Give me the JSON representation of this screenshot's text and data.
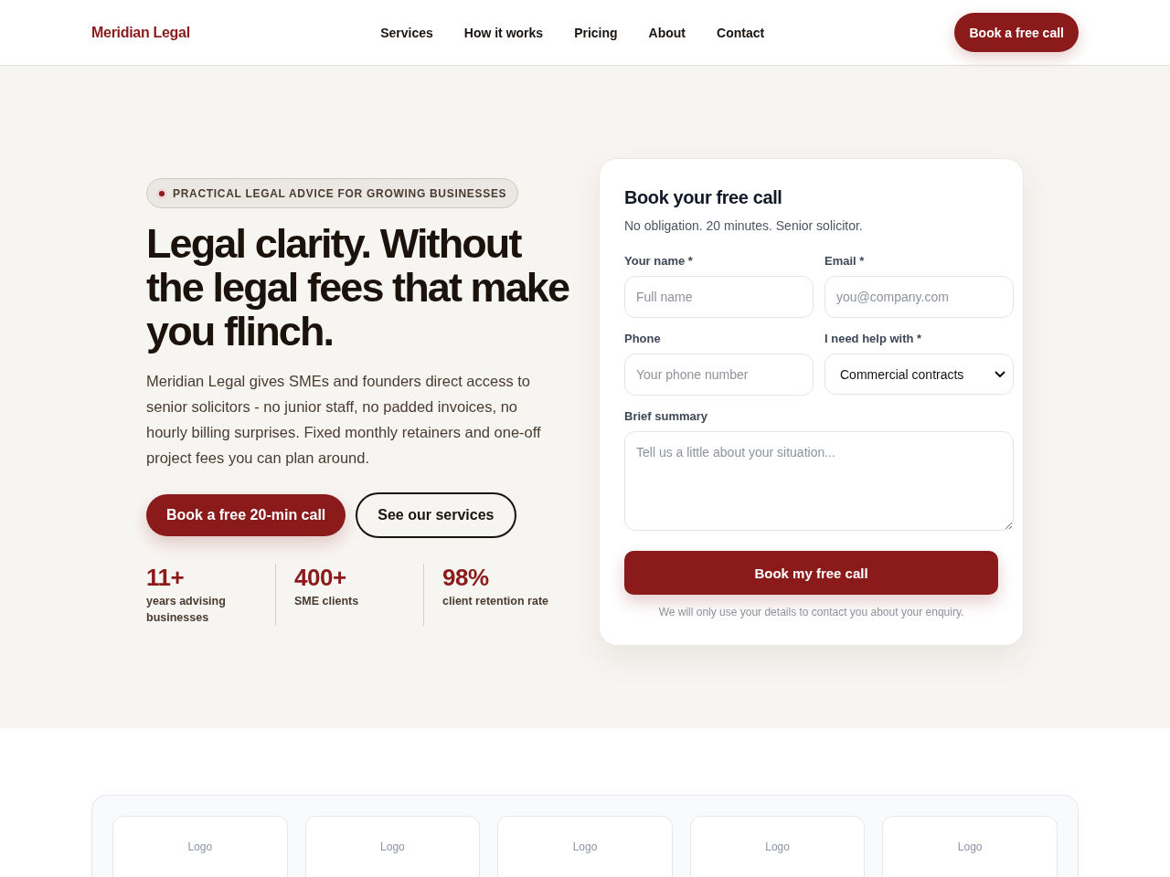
{
  "header": {
    "logo": "Meridian Legal",
    "nav": [
      {
        "label": "Services"
      },
      {
        "label": "How it works"
      },
      {
        "label": "Pricing"
      },
      {
        "label": "About"
      },
      {
        "label": "Contact"
      }
    ],
    "cta": "Book a free call"
  },
  "hero": {
    "badge": "PRACTICAL LEGAL ADVICE FOR GROWING BUSINESSES",
    "heading": "Legal clarity. Without the legal fees that make you flinch.",
    "description": "Meridian Legal gives SMEs and founders direct access to senior solicitors - no junior staff, no padded invoices, no hourly billing surprises. Fixed monthly retainers and one-off project fees you can plan around.",
    "buttons": [
      {
        "label": "Book a free 20-min call",
        "kind": "primary"
      },
      {
        "label": "See our services",
        "kind": "outline"
      }
    ],
    "stats": [
      {
        "value": "11+",
        "label": "years advising businesses"
      },
      {
        "value": "400+",
        "label": "SME clients"
      },
      {
        "value": "98%",
        "label": "client retention rate"
      }
    ]
  },
  "form": {
    "title": "Book your free call",
    "subtitle": "No obligation. 20 minutes. Senior solicitor.",
    "fields": [
      {
        "label": "Your name *",
        "kind": "input",
        "placeholder": "Full name"
      },
      {
        "label": "Email *",
        "kind": "input",
        "placeholder": "you@company.com"
      },
      {
        "label": "Phone",
        "kind": "input",
        "placeholder": "Your phone number"
      },
      {
        "label": "I need help with *",
        "kind": "select",
        "value": "Commercial contracts"
      },
      {
        "label": "Brief summary",
        "kind": "textarea",
        "placeholder": "Tell us a little about your situation..."
      }
    ],
    "submit": "Book my free call",
    "note": "We will only use your details to contact you about your enquiry."
  },
  "logos": [
    {
      "label": "Logo"
    },
    {
      "label": "Logo"
    },
    {
      "label": "Logo"
    },
    {
      "label": "Logo"
    },
    {
      "label": "Logo"
    }
  ]
}
